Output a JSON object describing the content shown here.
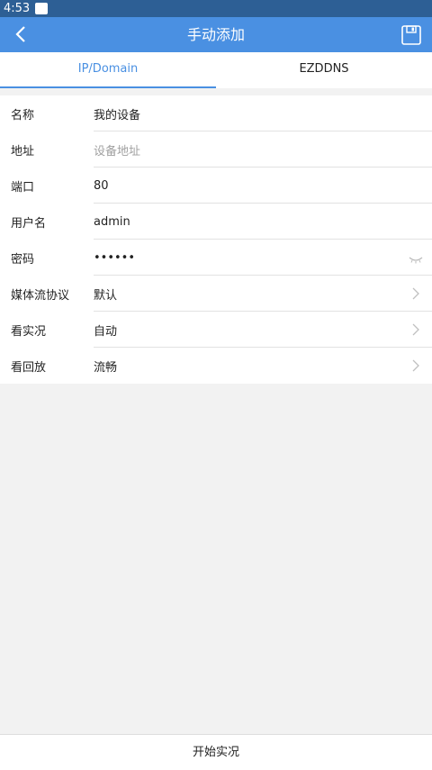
{
  "status_bar": {
    "time": "4:53"
  },
  "app_bar": {
    "title": "手动添加"
  },
  "tabs": [
    {
      "label": "IP/Domain",
      "active": true
    },
    {
      "label": "EZDDNS",
      "active": false
    }
  ],
  "form": {
    "rows": [
      {
        "label": "名称",
        "value": "我的设备"
      },
      {
        "label": "地址",
        "placeholder": "设备地址"
      },
      {
        "label": "端口",
        "value": "80"
      },
      {
        "label": "用户名",
        "value": "admin"
      },
      {
        "label": "密码",
        "value": "••••••"
      },
      {
        "label": "媒体流协议",
        "value": "默认"
      },
      {
        "label": "看实况",
        "value": "自动"
      },
      {
        "label": "看回放",
        "value": "流畅"
      }
    ]
  },
  "footer": {
    "button_label": "开始实况"
  },
  "colors": {
    "accent": "#4a90e2",
    "status_bar": "#2d5f95"
  }
}
